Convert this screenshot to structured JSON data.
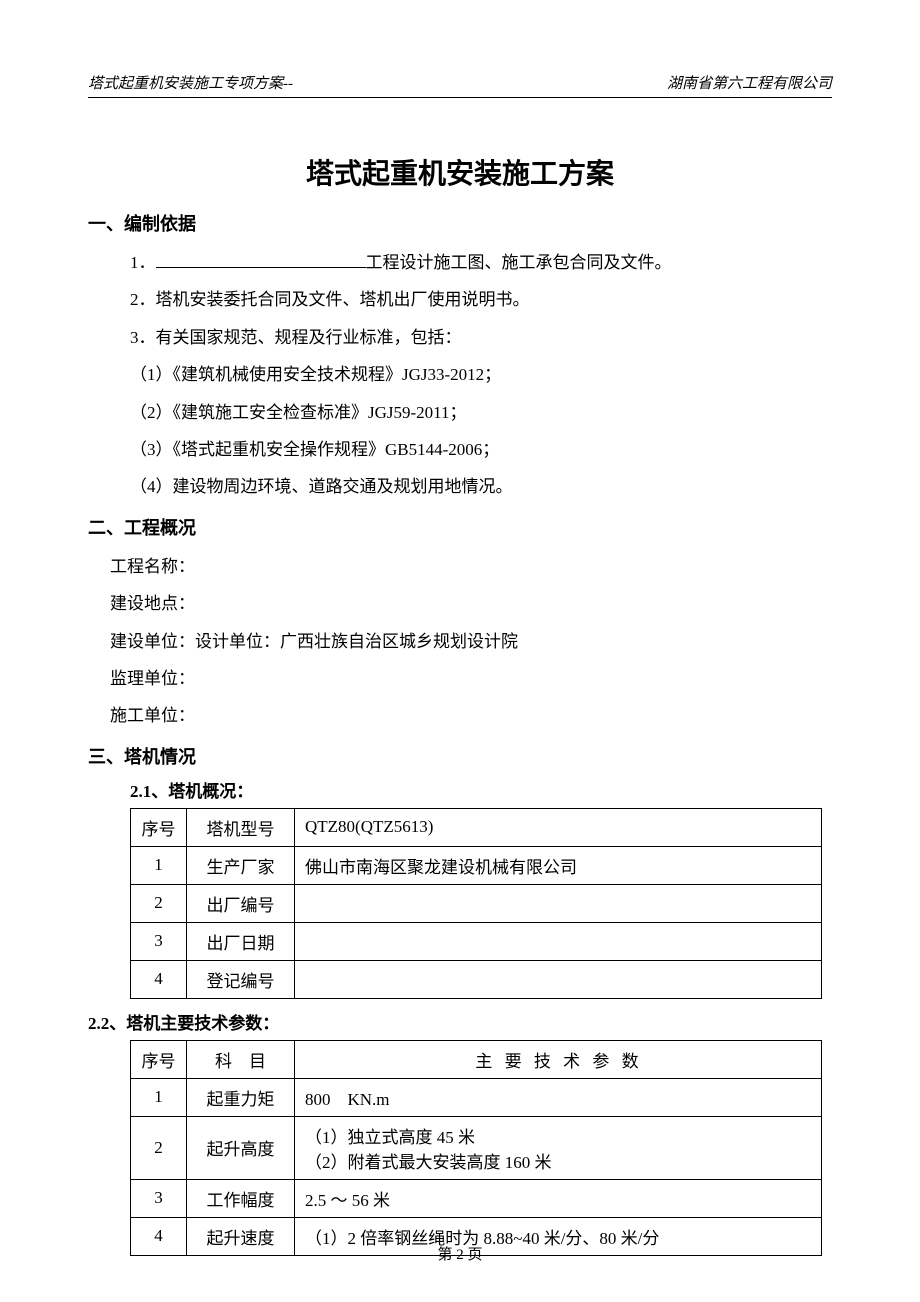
{
  "header": {
    "left": "塔式起重机安装施工专项方案--",
    "right": "湖南省第六工程有限公司"
  },
  "title": "塔式起重机安装施工方案",
  "sec1": {
    "head": "一、编制依据",
    "l1a": "1．",
    "l1b": "工程设计施工图、施工承包合同及文件。",
    "l2": "2．塔机安装委托合同及文件、塔机出厂使用说明书。",
    "l3": "3．有关国家规范、规程及行业标准，包括：",
    "l4": "（1）《建筑机械使用安全技术规程》JGJ33-2012；",
    "l5": "（2）《建筑施工安全检查标准》JGJ59-2011；",
    "l6": "（3）《塔式起重机安全操作规程》GB5144-2006；",
    "l7": "（4）建设物周边环境、道路交通及规划用地情况。"
  },
  "sec2": {
    "head": "二、工程概况",
    "l1": "工程名称：",
    "l2": "建设地点：",
    "l3": "建设单位：设计单位：广西壮族自治区城乡规划设计院",
    "l4": "监理单位：",
    "l5": "施工单位："
  },
  "sec3": {
    "head": "三、塔机情况"
  },
  "t1": {
    "caption": "2.1、塔机概况：",
    "h_seq": "序号",
    "h_lab": "塔机型号",
    "h_val": "QTZ80(QTZ5613)",
    "rows": [
      {
        "seq": "1",
        "lab": "生产厂家",
        "val": "佛山市南海区聚龙建设机械有限公司"
      },
      {
        "seq": "2",
        "lab": "出厂编号",
        "val": ""
      },
      {
        "seq": "3",
        "lab": "出厂日期",
        "val": ""
      },
      {
        "seq": "4",
        "lab": "登记编号",
        "val": ""
      }
    ]
  },
  "t2": {
    "caption": "2.2、塔机主要技术参数：",
    "h_seq": "序号",
    "h_lab": "科　目",
    "h_val": "主 要 技 术 参 数",
    "rows": [
      {
        "seq": "1",
        "lab": "起重力矩",
        "val": "800　KN.m"
      },
      {
        "seq": "2",
        "lab": "起升高度",
        "val": "（1）独立式高度 45 米\n（2）附着式最大安装高度 160 米"
      },
      {
        "seq": "3",
        "lab": "工作幅度",
        "val": "2.5 ～ 56 米"
      },
      {
        "seq": "4",
        "lab": "起升速度",
        "val": "（1）2 倍率钢丝绳时为 8.88~40 米/分、80 米/分"
      }
    ]
  },
  "footer": "第 2 页"
}
